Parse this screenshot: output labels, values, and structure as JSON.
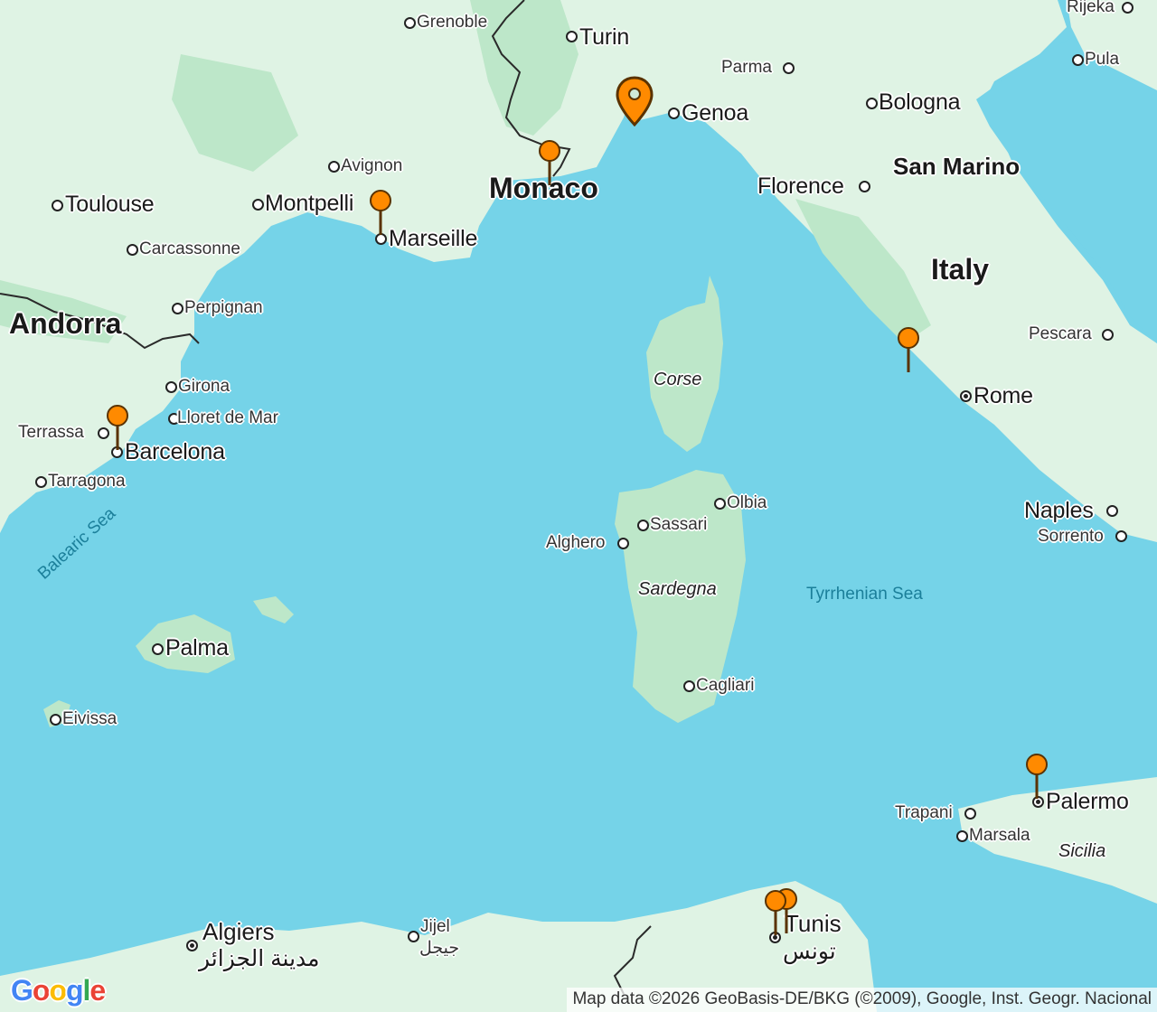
{
  "map": {
    "cities": [
      {
        "id": "grenoble",
        "label": "Grenoble"
      },
      {
        "id": "turin",
        "label": "Turin"
      },
      {
        "id": "parma",
        "label": "Parma"
      },
      {
        "id": "rijeka",
        "label": "Rijeka"
      },
      {
        "id": "pula",
        "label": "Pula"
      },
      {
        "id": "genoa",
        "label": "Genoa"
      },
      {
        "id": "bologna",
        "label": "Bologna"
      },
      {
        "id": "avignon",
        "label": "Avignon"
      },
      {
        "id": "toulouse",
        "label": "Toulouse"
      },
      {
        "id": "montpellier",
        "label": "Montpelli"
      },
      {
        "id": "marseille",
        "label": "Marseille"
      },
      {
        "id": "carcassonne",
        "label": "Carcassonne"
      },
      {
        "id": "perpignan",
        "label": "Perpignan"
      },
      {
        "id": "florence",
        "label": "Florence"
      },
      {
        "id": "pescara",
        "label": "Pescara"
      },
      {
        "id": "rome",
        "label": "Rome"
      },
      {
        "id": "girona",
        "label": "Girona"
      },
      {
        "id": "lloret",
        "label": "Lloret de Mar"
      },
      {
        "id": "terrassa",
        "label": "Terrassa"
      },
      {
        "id": "barcelona",
        "label": "Barcelona"
      },
      {
        "id": "tarragona",
        "label": "Tarragona"
      },
      {
        "id": "olbia",
        "label": "Olbia"
      },
      {
        "id": "sassari",
        "label": "Sassari"
      },
      {
        "id": "alghero",
        "label": "Alghero"
      },
      {
        "id": "naples",
        "label": "Naples"
      },
      {
        "id": "sorrento",
        "label": "Sorrento"
      },
      {
        "id": "palma",
        "label": "Palma"
      },
      {
        "id": "cagliari",
        "label": "Cagliari"
      },
      {
        "id": "eivissa",
        "label": "Eivissa"
      },
      {
        "id": "palermo",
        "label": "Palermo"
      },
      {
        "id": "trapani",
        "label": "Trapani"
      },
      {
        "id": "marsala",
        "label": "Marsala"
      },
      {
        "id": "algiers",
        "label": "Algiers"
      },
      {
        "id": "algiers_ar",
        "label": "مدينة الجزائر"
      },
      {
        "id": "jijel",
        "label": "Jijel"
      },
      {
        "id": "jijel_ar",
        "label": "جيجل"
      },
      {
        "id": "tunis",
        "label": "Tunis"
      },
      {
        "id": "tunis_ar",
        "label": "تونس"
      }
    ],
    "countries": {
      "monaco": "Monaco",
      "andorra": "Andorra",
      "italy": "Italy",
      "san_marino": "San Marino"
    },
    "regions": {
      "corse": "Corse",
      "sardegna": "Sardegna",
      "sicilia": "Sicilia"
    },
    "seas": {
      "balearic": "Balearic Sea",
      "tyrrhenian": "Tyrrhenian Sea"
    },
    "markers": {
      "selected": "Genoa area (selected marker)",
      "pins": [
        "Monaco",
        "Marseille",
        "Barcelona",
        "Italy coast",
        "Palermo",
        "Tunis",
        "Tunis"
      ]
    },
    "colors": {
      "water": "#75d3e8",
      "land": "#dff3e4",
      "forest": "#bde7c9",
      "pin": "#ff8a00",
      "pin_outline": "#5a3200"
    }
  },
  "footer": {
    "logo": "Google",
    "attribution": "Map data ©2026 GeoBasis-DE/BKG (©2009), Google, Inst. Geogr. Nacional"
  }
}
